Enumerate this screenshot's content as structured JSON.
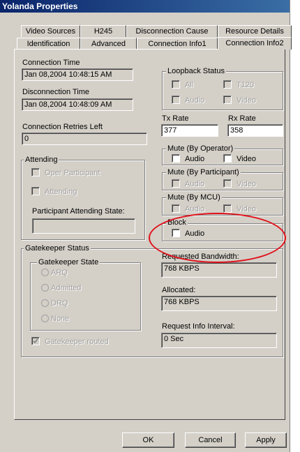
{
  "window": {
    "title": "Yolanda Properties"
  },
  "tabs_row1": [
    "Video Sources",
    "H245",
    "Disconnection Cause",
    "Resource Details"
  ],
  "tabs_row2": [
    "Identification",
    "Advanced",
    "Connection Info1",
    "Connection Info2"
  ],
  "active_tab": "Connection Info2",
  "connection": {
    "connection_time_label": "Connection Time",
    "connection_time_value": "Jan 08,2004  10:48:15 AM",
    "disconnection_time_label": "Disconnection Time",
    "disconnection_time_value": "Jan 08,2004  10:48:09 AM",
    "retries_label": "Connection Retries Left",
    "retries_value": "0"
  },
  "attending": {
    "title": "Attending",
    "oper_participant": "Oper Participant",
    "attending": "Attending",
    "state_label": "Participant Attending State:",
    "state_value": ""
  },
  "loopback": {
    "title": "Loopback Status",
    "all": "All",
    "t120": "T120",
    "audio": "Audio",
    "video": "Video"
  },
  "rates": {
    "tx_label": "Tx Rate",
    "tx_value": "377",
    "rx_label": "Rx Rate",
    "rx_value": "358"
  },
  "mute_operator": {
    "title": "Mute (By Operator)",
    "audio": "Audio",
    "video": "Video"
  },
  "mute_participant": {
    "title": "Mute (By Participant)",
    "audio": "Audio",
    "video": "Video"
  },
  "mute_mcu": {
    "title": "Mute (By MCU)",
    "audio": "Audio",
    "video": "Video"
  },
  "block": {
    "title": "Block",
    "audio": "Audio"
  },
  "gatekeeper": {
    "title": "Gatekeeper Status",
    "state_title": "Gatekeeper State",
    "states": [
      "ARQ",
      "Admitted",
      "DRQ",
      "None"
    ],
    "routed": "Gatekeeper routed",
    "requested_label": "Requested Bandwidth:",
    "requested_value": "768  KBPS",
    "allocated_label": "Allocated:",
    "allocated_value": "768  KBPS",
    "interval_label": "Request Info Interval:",
    "interval_value": "0  Sec"
  },
  "buttons": {
    "ok": "OK",
    "cancel": "Cancel",
    "apply": "Apply"
  },
  "colors": {
    "titlebar": "#0a246a",
    "dialog": "#d4d0c8",
    "highlight_ellipse": "#e0101a"
  }
}
